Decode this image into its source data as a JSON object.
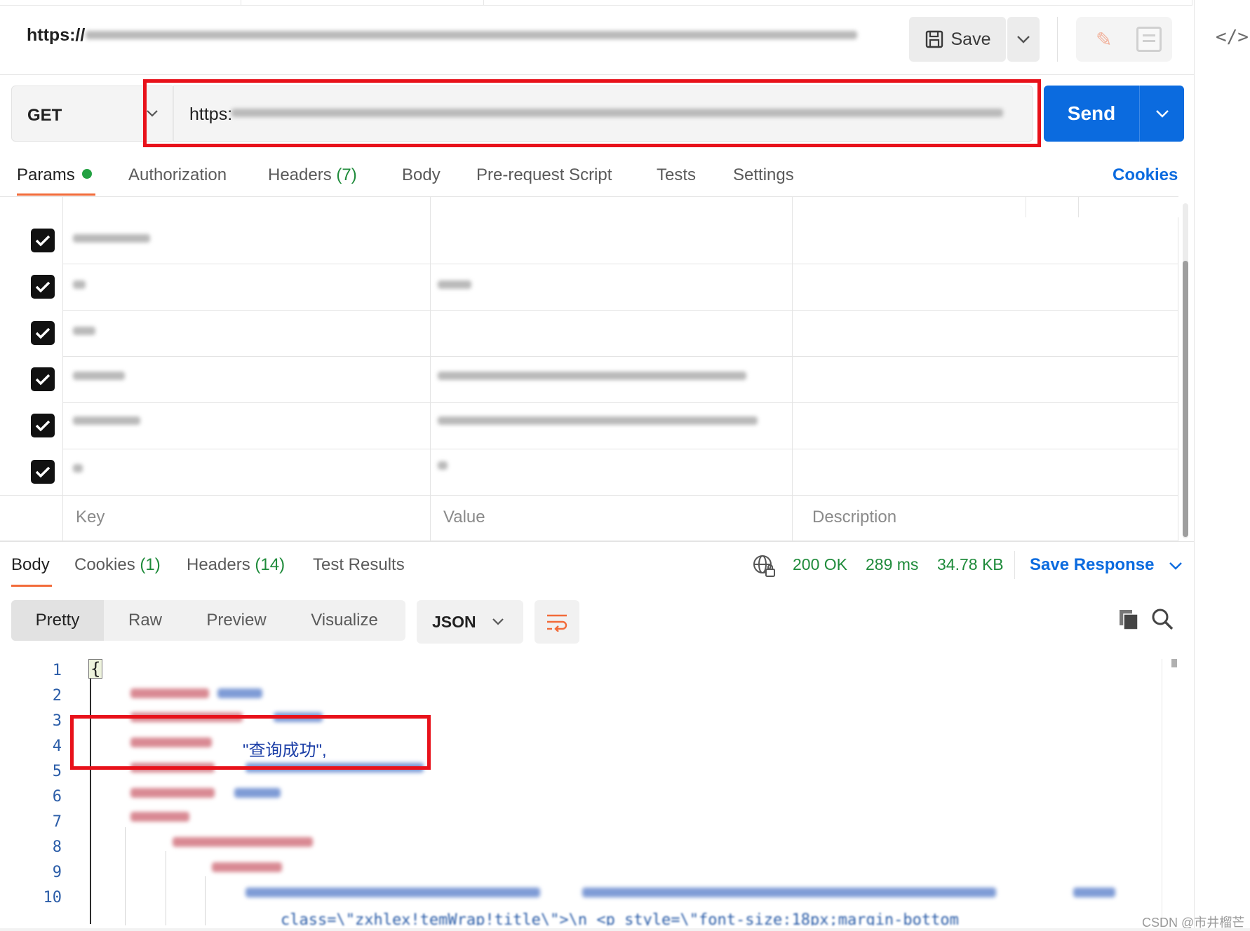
{
  "title_bar": {
    "url_prefix": "https://",
    "save_label": "Save"
  },
  "request": {
    "method": "GET",
    "url_prefix": "https:",
    "send_label": "Send"
  },
  "request_tabs": [
    {
      "label": "Params",
      "count": "",
      "active": true,
      "dot": true
    },
    {
      "label": "Authorization",
      "count": ""
    },
    {
      "label": "Headers",
      "count": "(7)"
    },
    {
      "label": "Body",
      "count": ""
    },
    {
      "label": "Pre-request Script",
      "count": ""
    },
    {
      "label": "Tests",
      "count": ""
    },
    {
      "label": "Settings",
      "count": ""
    }
  ],
  "cookies_link": "Cookies",
  "params_table": {
    "rows_checked": [
      true,
      true,
      true,
      true,
      true,
      true
    ],
    "new_row": {
      "key_placeholder": "Key",
      "value_placeholder": "Value",
      "description_placeholder": "Description"
    }
  },
  "response_tabs": [
    {
      "label": "Body",
      "count": "",
      "active": true
    },
    {
      "label": "Cookies",
      "count": "(1)"
    },
    {
      "label": "Headers",
      "count": "(14)"
    },
    {
      "label": "Test Results",
      "count": ""
    }
  ],
  "response_status": {
    "status": "200 OK",
    "time": "289 ms",
    "size": "34.78 KB",
    "save_response_label": "Save Response"
  },
  "view_modes": [
    "Pretty",
    "Raw",
    "Preview",
    "Visualize"
  ],
  "active_view": "Pretty",
  "format_select": "JSON",
  "code": {
    "line_numbers": [
      "1",
      "2",
      "3",
      "4",
      "5",
      "6",
      "7",
      "8",
      "9",
      "10"
    ],
    "open_brace": "{",
    "message_value": "\"查询成功\",",
    "line10_fragment": "class=\\\"zxhlex!temWrap!title\\\">\\n    <p  style=\\\"font-size:18px;margin-bottom"
  },
  "watermark": "CSDN @市井榴芒",
  "colors": {
    "accent_orange": "#f26b3a",
    "send_blue": "#0b6bdf",
    "status_green": "#1f8b3b",
    "highlight_red": "#e8111a"
  }
}
